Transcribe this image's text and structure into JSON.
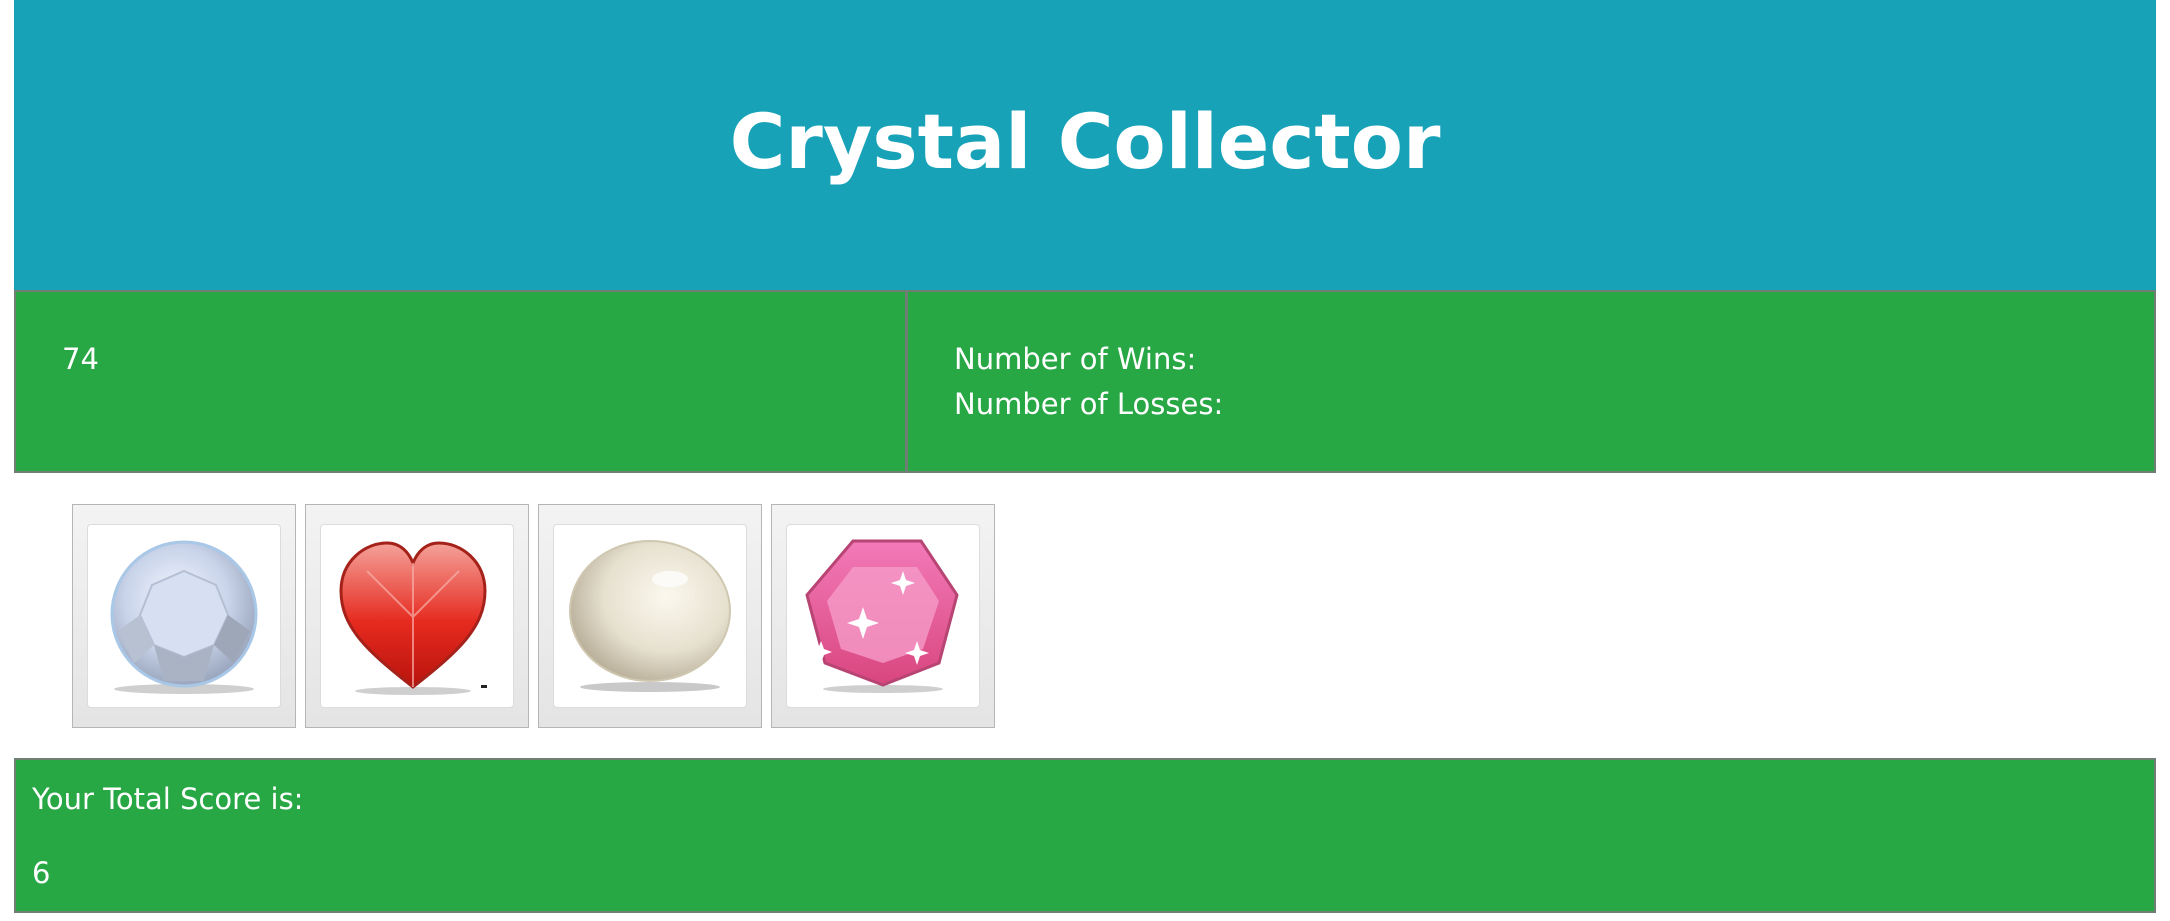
{
  "header": {
    "title": "Crystal Collector"
  },
  "stats": {
    "target_number": "74",
    "wins_label": "Number of Wins:",
    "losses_label": "Number of Losses:"
  },
  "crystals": [
    {
      "name": "diamond",
      "icon": "white-diamond-icon"
    },
    {
      "name": "heart",
      "icon": "red-heart-gem-icon"
    },
    {
      "name": "pearl",
      "icon": "pearl-icon"
    },
    {
      "name": "pink-gem",
      "icon": "pink-gem-icon"
    }
  ],
  "score": {
    "label": "Your Total Score is:",
    "value": "6"
  },
  "colors": {
    "header_bg": "#17a2b8",
    "panel_bg": "#28a745",
    "text": "#ffffff"
  }
}
